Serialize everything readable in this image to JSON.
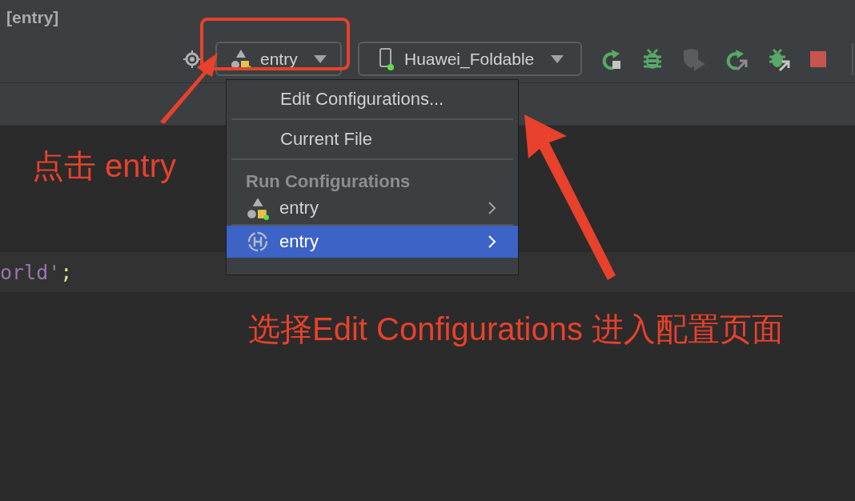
{
  "window": {
    "title": "[entry]"
  },
  "toolbar": {
    "config_selector": {
      "label": "entry"
    },
    "device_selector": {
      "label": "Huawei_Foldable"
    }
  },
  "dropdown": {
    "items": [
      {
        "kind": "action",
        "label": "Edit Configurations...",
        "selected": false
      },
      {
        "kind": "action",
        "label": "Current File",
        "selected": false
      },
      {
        "kind": "header",
        "label": "Run Configurations"
      },
      {
        "kind": "module",
        "label": "entry",
        "selected": false
      },
      {
        "kind": "harmony",
        "label": "entry",
        "selected": true
      }
    ]
  },
  "editor": {
    "line": {
      "string": "orld'",
      "punct": ";"
    }
  },
  "annotations": {
    "click_note": "点击 entry",
    "select_note": "选择Edit Configurations 进入配置页面"
  }
}
